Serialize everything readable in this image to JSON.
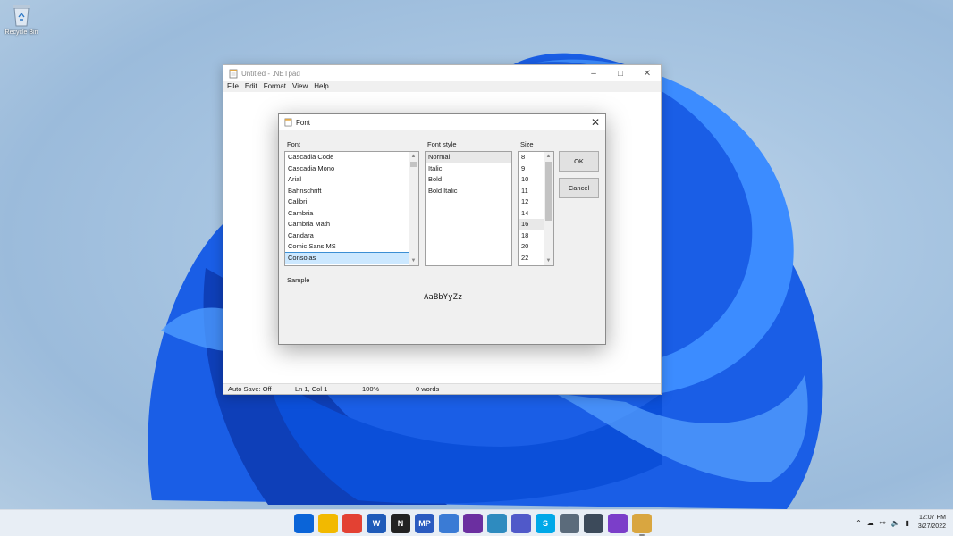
{
  "desktop": {
    "recycle_bin_label": "Recycle Bin"
  },
  "notepad": {
    "title": "Untitled - .NETpad",
    "menu": [
      "File",
      "Edit",
      "Format",
      "View",
      "Help"
    ],
    "status": {
      "auto_save": "Auto Save: Off",
      "position": "Ln 1, Col 1",
      "zoom": "100%",
      "words": "0 words"
    }
  },
  "font_dialog": {
    "title": "Font",
    "font_label": "Font",
    "style_label": "Font style",
    "size_label": "Size",
    "fonts": [
      "Cascadia Code",
      "Cascadia Mono",
      "Arial",
      "Bahnschrift",
      "Calibri",
      "Cambria",
      "Cambria Math",
      "Candara",
      "Comic Sans MS",
      "Consolas"
    ],
    "selected_font": "Consolas",
    "styles": [
      "Normal",
      "Italic",
      "Bold",
      "Bold Italic"
    ],
    "selected_style": "Normal",
    "sizes": [
      "8",
      "9",
      "10",
      "11",
      "12",
      "14",
      "16",
      "18",
      "20",
      "22"
    ],
    "selected_size": "16",
    "ok_label": "OK",
    "cancel_label": "Cancel",
    "sample_label": "Sample",
    "sample_text": "AaBbYyZz"
  },
  "taskbar": {
    "clock_time": "12:07 PM",
    "clock_date": "3/27/2022",
    "apps": [
      {
        "name": "start-icon",
        "color": "#0a64d8"
      },
      {
        "name": "file-explorer-icon",
        "color": "#f2b900"
      },
      {
        "name": "chrome-icon",
        "color": "#e34133"
      },
      {
        "name": "word-icon",
        "color": "#1f5bb9",
        "text": "W"
      },
      {
        "name": "notion-icon",
        "color": "#222222",
        "text": "N"
      },
      {
        "name": "mp-icon",
        "color": "#2b5bc0",
        "text": "MP"
      },
      {
        "name": "notes-icon",
        "color": "#3a7bd5"
      },
      {
        "name": "terminal-icon",
        "color": "#6b2fa0"
      },
      {
        "name": "globe-icon",
        "color": "#2e8bbf"
      },
      {
        "name": "teams-icon",
        "color": "#5059c9"
      },
      {
        "name": "skype-icon",
        "color": "#00a8e8",
        "text": "S"
      },
      {
        "name": "settings-icon",
        "color": "#5b6b7b"
      },
      {
        "name": "screen-icon",
        "color": "#3c4a5a"
      },
      {
        "name": "visual-studio-icon",
        "color": "#7b3ec9"
      },
      {
        "name": "notepad-app-icon",
        "color": "#d9a640"
      }
    ]
  }
}
